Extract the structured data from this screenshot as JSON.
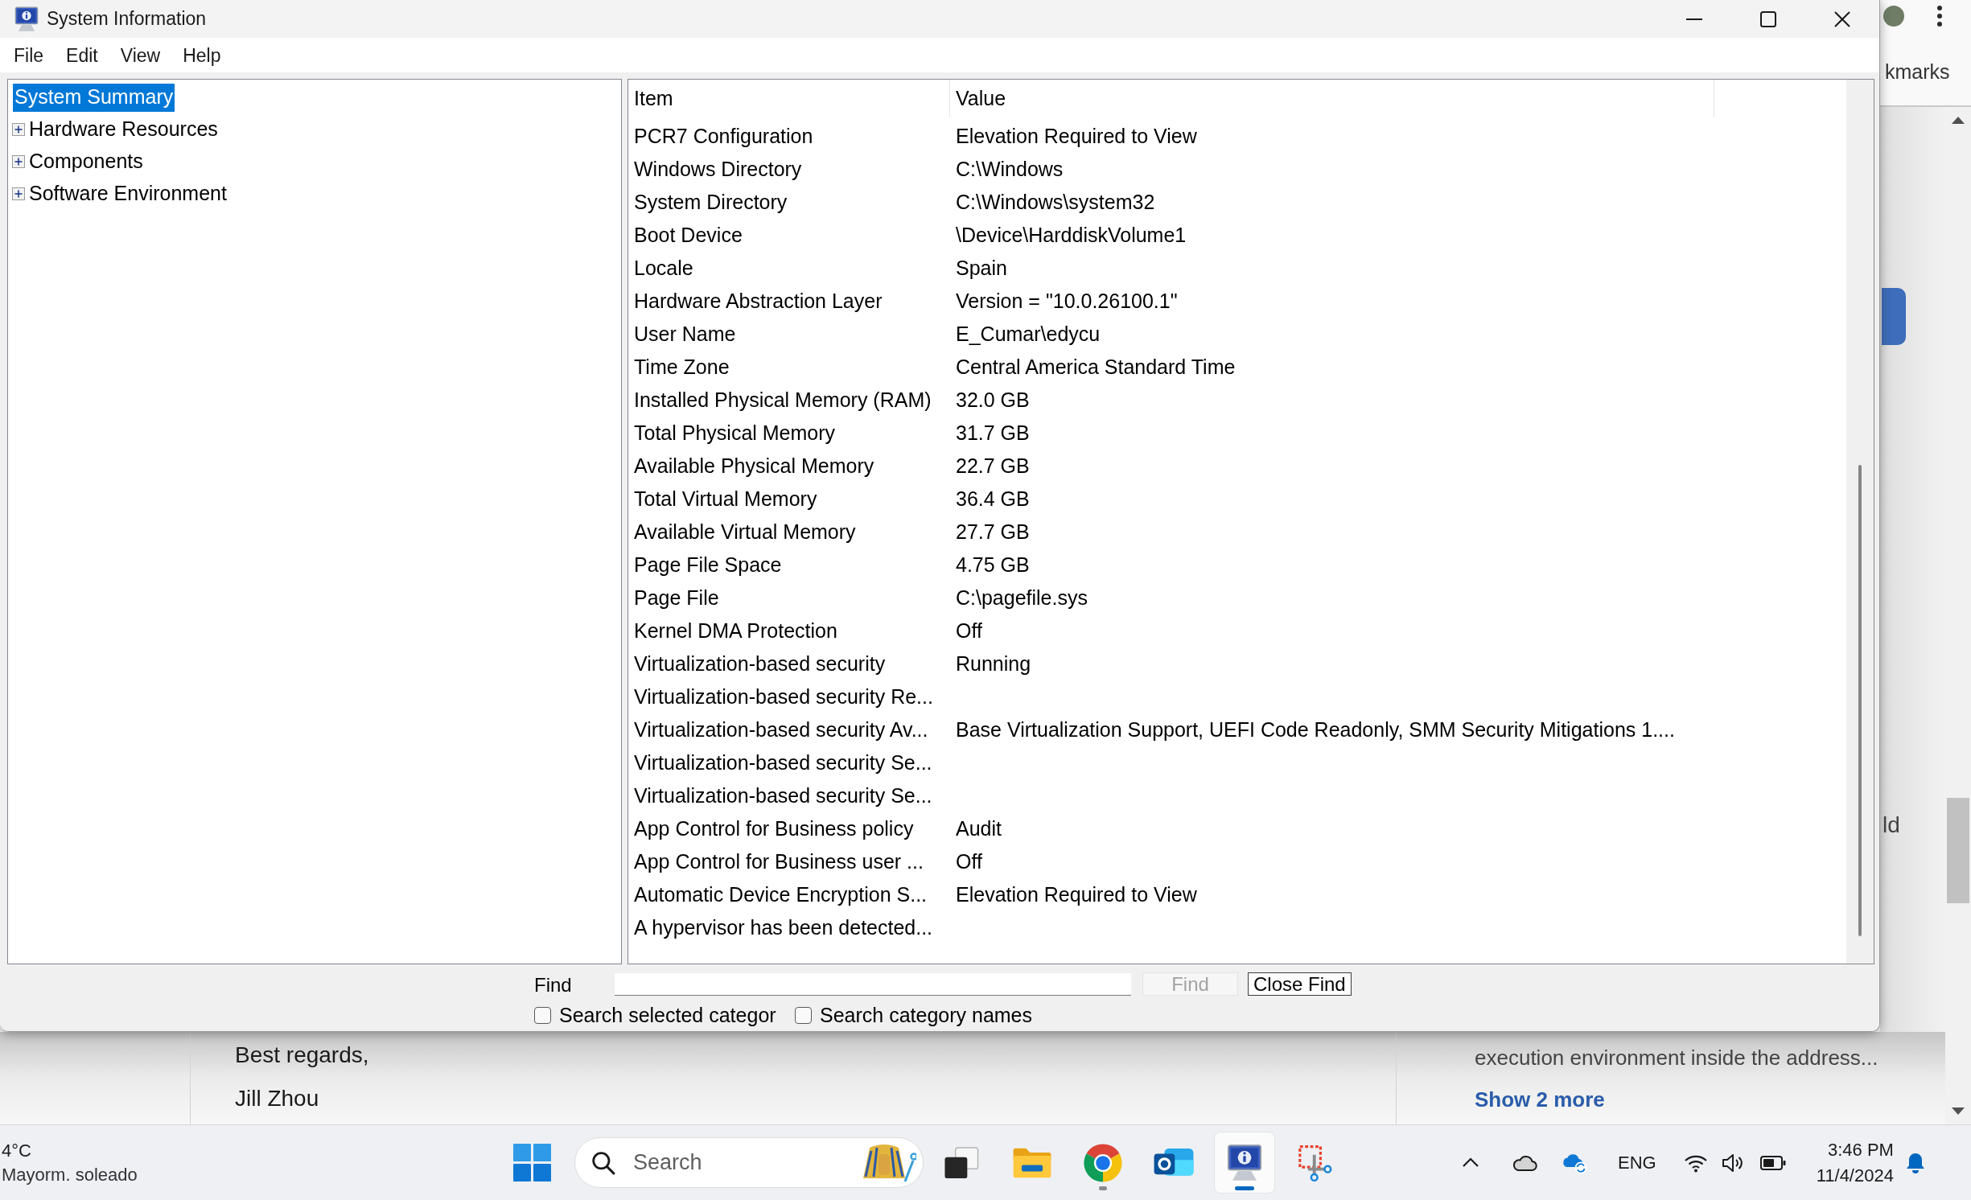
{
  "window": {
    "title": "System Information",
    "menu": [
      "File",
      "Edit",
      "View",
      "Help"
    ]
  },
  "tree": [
    {
      "label": "System Summary",
      "selected": true,
      "children": [
        {
          "label": "Hardware Resources",
          "selected": false,
          "expanded": false
        },
        {
          "label": "Components",
          "selected": false,
          "expanded": false
        },
        {
          "label": "Software Environment",
          "selected": false,
          "expanded": false
        }
      ]
    }
  ],
  "table": {
    "columns": [
      "Item",
      "Value"
    ],
    "rows": [
      {
        "item": "PCR7 Configuration",
        "value": "Elevation Required to View"
      },
      {
        "item": "Windows Directory",
        "value": "C:\\Windows"
      },
      {
        "item": "System Directory",
        "value": "C:\\Windows\\system32"
      },
      {
        "item": "Boot Device",
        "value": "\\Device\\HarddiskVolume1"
      },
      {
        "item": "Locale",
        "value": "Spain"
      },
      {
        "item": "Hardware Abstraction Layer",
        "value": "Version = \"10.0.26100.1\""
      },
      {
        "item": "User Name",
        "value": "E_Cumar\\edycu"
      },
      {
        "item": "Time Zone",
        "value": "Central America Standard Time"
      },
      {
        "item": "Installed Physical Memory (RAM)",
        "value": "32.0 GB"
      },
      {
        "item": "Total Physical Memory",
        "value": "31.7 GB"
      },
      {
        "item": "Available Physical Memory",
        "value": "22.7 GB"
      },
      {
        "item": "Total Virtual Memory",
        "value": "36.4 GB"
      },
      {
        "item": "Available Virtual Memory",
        "value": "27.7 GB"
      },
      {
        "item": "Page File Space",
        "value": "4.75 GB"
      },
      {
        "item": "Page File",
        "value": "C:\\pagefile.sys"
      },
      {
        "item": "Kernel DMA Protection",
        "value": "Off"
      },
      {
        "item": "Virtualization-based security",
        "value": "Running"
      },
      {
        "item": "Virtualization-based security Re..."
      },
      {
        "item": "Virtualization-based security Av...",
        "value": "Base Virtualization Support, UEFI Code Readonly, SMM Security Mitigations 1...."
      },
      {
        "item": "Virtualization-based security Se..."
      },
      {
        "item": "Virtualization-based security Se..."
      },
      {
        "item": "App Control for Business policy",
        "value": "Audit"
      },
      {
        "item": "App Control for Business user ...",
        "value": "Off"
      },
      {
        "item": "Automatic Device Encryption S...",
        "value": "Elevation Required to View"
      },
      {
        "item": "A hypervisor has been detected..."
      }
    ]
  },
  "find": {
    "label": "Find",
    "buttons": [
      {
        "label": "Find",
        "disabled": true
      },
      {
        "label": "Close Find",
        "disabled": false
      }
    ],
    "options": [
      {
        "label": "Search selected categor",
        "checked": false
      },
      {
        "label": "Search category names",
        "checked": false
      }
    ]
  },
  "browser": {
    "bookmarks_label": "kmarks",
    "text_fragment": "ld",
    "email_lines": [
      "Best regards,",
      "Jill Zhou"
    ],
    "side_text": "execution environment inside the address...",
    "side_link": "Show 2 more"
  },
  "taskbar": {
    "weather": {
      "temperature": "4°C",
      "condition": "Mayorm. soleado"
    },
    "search": {
      "label": "Search"
    },
    "buttons": [
      {
        "running": false,
        "selected": false
      },
      {
        "running": false,
        "selected": false
      },
      {
        "running": true,
        "selected": false
      },
      {
        "running": false,
        "selected": false
      },
      {
        "running": true,
        "selected": true
      },
      {
        "running": false,
        "selected": false
      }
    ],
    "tray": {
      "language": "ENG",
      "time": "3:46 PM",
      "date": "11/4/2024"
    }
  }
}
